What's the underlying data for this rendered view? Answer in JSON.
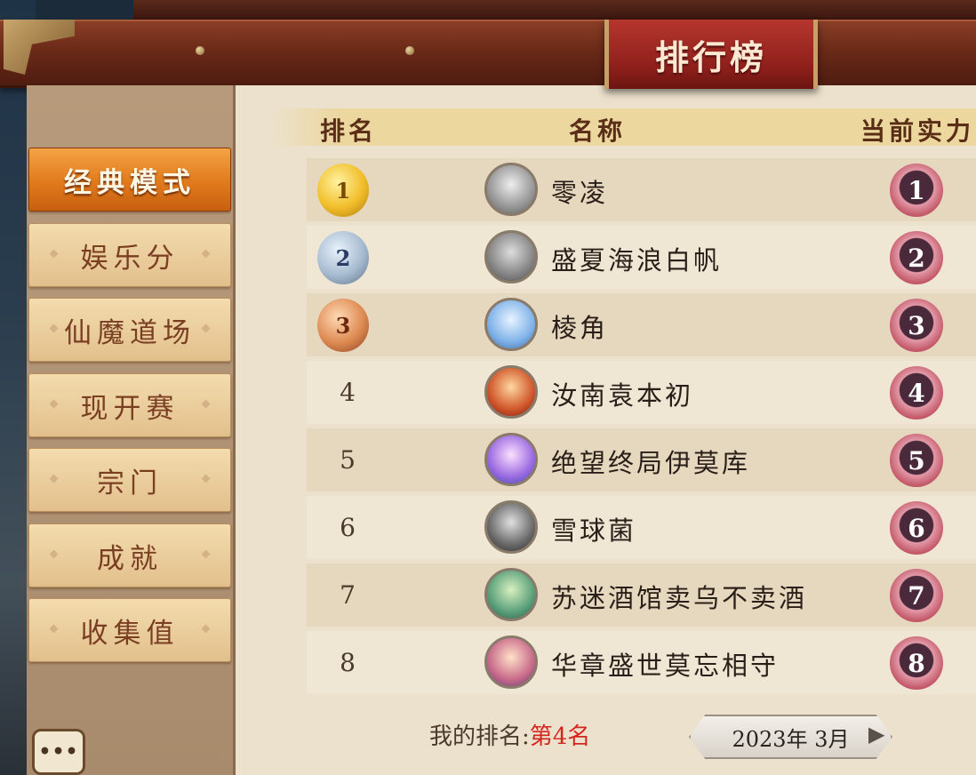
{
  "title": "排行榜",
  "sidebar": {
    "items": [
      {
        "label": "经典模式",
        "active": true
      },
      {
        "label": "娱乐分",
        "active": false
      },
      {
        "label": "仙魔道场",
        "active": false
      },
      {
        "label": "现开赛",
        "active": false
      },
      {
        "label": "宗门",
        "active": false
      },
      {
        "label": "成就",
        "active": false
      },
      {
        "label": "收集值",
        "active": false
      }
    ],
    "chat_label": "•••"
  },
  "table": {
    "headers": {
      "rank": "排名",
      "name": "名称",
      "power": "当前实力"
    },
    "rows": [
      {
        "rank": "1",
        "name": "零凌",
        "power": "1"
      },
      {
        "rank": "2",
        "name": "盛夏海浪白帆",
        "power": "2"
      },
      {
        "rank": "3",
        "name": "棱角",
        "power": "3"
      },
      {
        "rank": "4",
        "name": "汝南袁本初",
        "power": "4"
      },
      {
        "rank": "5",
        "name": "绝望终局伊莫库",
        "power": "5"
      },
      {
        "rank": "6",
        "name": "雪球菌",
        "power": "6"
      },
      {
        "rank": "7",
        "name": "苏迷酒馆卖乌不卖酒",
        "power": "7"
      },
      {
        "rank": "8",
        "name": "华章盛世莫忘相守",
        "power": "8"
      }
    ]
  },
  "footer": {
    "my_rank_label": "我的排名:",
    "my_rank_value": "第4名",
    "date": "2023年 3月"
  },
  "colors": {
    "accent": "#e07a1c",
    "banner": "#8e1f1b",
    "highlight": "#d4261e"
  }
}
